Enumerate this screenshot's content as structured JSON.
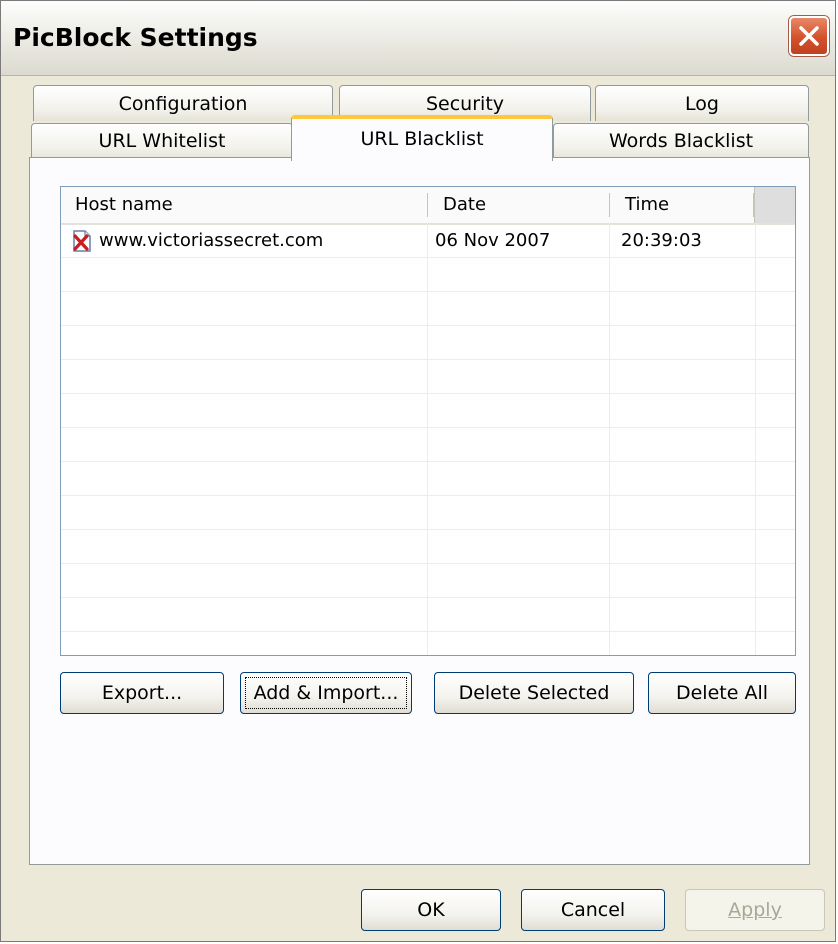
{
  "window": {
    "title": "PicBlock Settings"
  },
  "tabs": {
    "row1": [
      "Configuration",
      "Security",
      "Log"
    ],
    "row2": [
      "URL Whitelist",
      "URL Blacklist",
      "Words Blacklist"
    ],
    "active": "URL Blacklist"
  },
  "list": {
    "columns": [
      "Host name",
      "Date",
      "Time"
    ],
    "rows": [
      {
        "icon": "blocked-page-icon",
        "host": "www.victoriassecret.com",
        "date": "06 Nov 2007",
        "time": "20:39:03"
      }
    ]
  },
  "panel_buttons": {
    "export": "Export...",
    "add_import": "Add & Import...",
    "delete_selected": "Delete Selected",
    "delete_all": "Delete All"
  },
  "dialog_buttons": {
    "ok": "OK",
    "cancel": "Cancel",
    "apply": "Apply"
  },
  "colors": {
    "active_tab_accent": "#ffc83c",
    "close_button": "#d4512c",
    "dialog_background": "#ece9d8"
  }
}
